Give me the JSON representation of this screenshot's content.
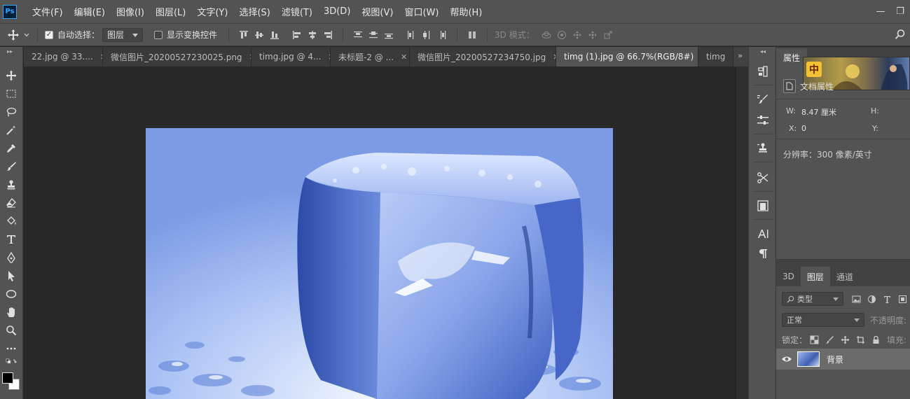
{
  "app": {
    "logo": "Ps"
  },
  "menu": [
    "文件(F)",
    "编辑(E)",
    "图像(I)",
    "图层(L)",
    "文字(Y)",
    "选择(S)",
    "滤镜(T)",
    "3D(D)",
    "视图(V)",
    "窗口(W)",
    "帮助(H)"
  ],
  "window_controls": {
    "minimize": "—",
    "restore": "❐"
  },
  "options": {
    "auto_select_label": "自动选择：",
    "auto_select_checked": true,
    "auto_select_target": "图层",
    "show_transform_label": "显示变换控件",
    "show_transform_checked": false,
    "mode_3d_label": "3D 模式："
  },
  "tabs": [
    {
      "label": "22.jpg @ 33....",
      "active": false
    },
    {
      "label": "微信图片_20200527230025.png",
      "active": false
    },
    {
      "label": "timg.jpg @ 4...",
      "active": false
    },
    {
      "label": "未标题-2 @ ...",
      "active": false
    },
    {
      "label": "微信图片_20200527234750.jpg",
      "active": false
    },
    {
      "label": "timg (1).jpg @ 66.7%(RGB/8#)",
      "active": true
    },
    {
      "label": "timg",
      "active": false
    }
  ],
  "tabs_overflow": "»",
  "properties": {
    "title": "属性",
    "thumb_char": "中",
    "doc_label": "文档属性",
    "w_label": "W:",
    "w_value": "8.47 厘米",
    "h_label": "H:",
    "x_label": "X:",
    "x_value": "0",
    "y_label": "Y:",
    "resolution": "分辨率：300 像素/英寸"
  },
  "layers": {
    "tabs": [
      "3D",
      "图层",
      "通道"
    ],
    "active_tab": "图层",
    "filter_placeholder": "类型",
    "blend_mode": "正常",
    "opacity_label": "不透明度:",
    "lock_label": "锁定：",
    "fill_label": "填充:",
    "layer_name": "背景"
  },
  "colors": {
    "foreground": "#000000",
    "background": "#ffffff",
    "ui_panel": "#535353"
  }
}
